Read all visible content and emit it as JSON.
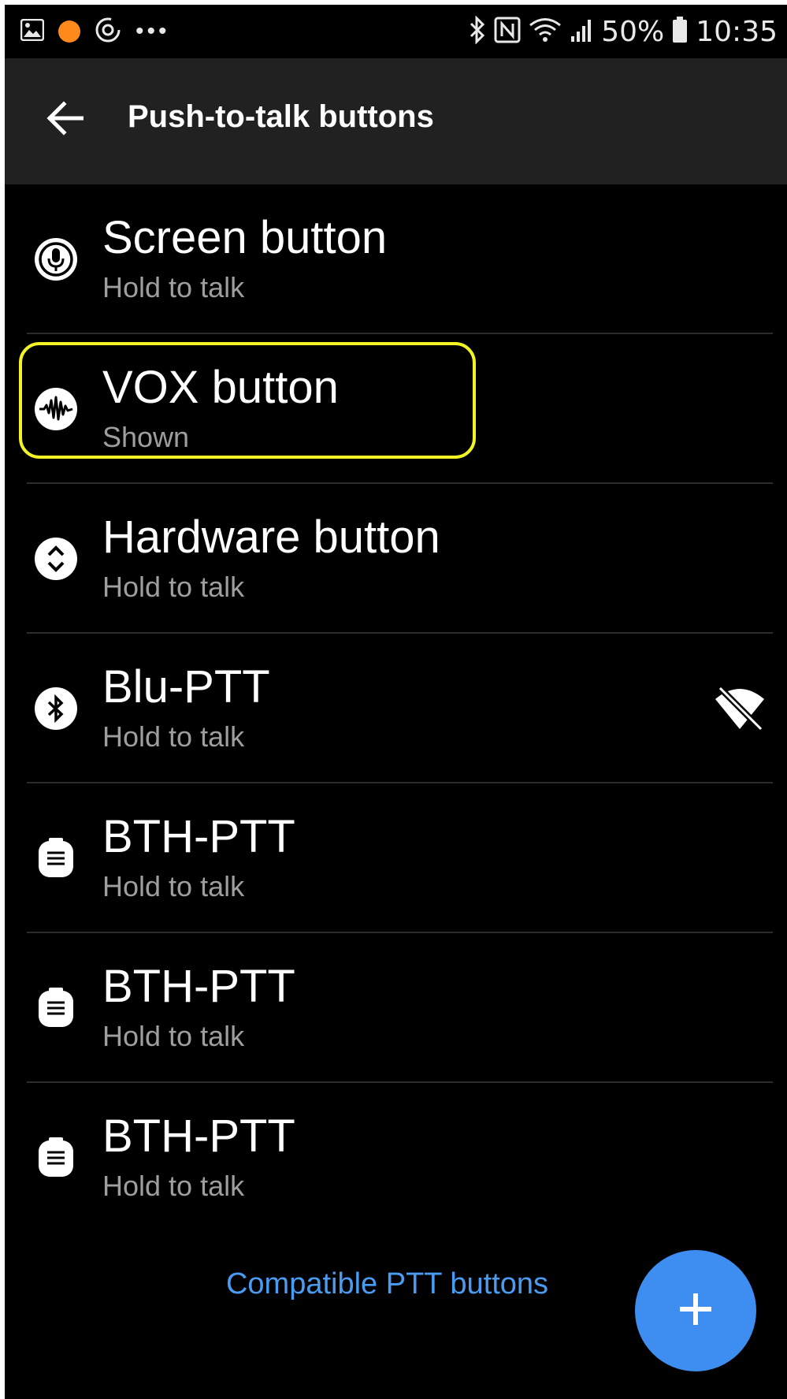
{
  "status_bar": {
    "battery_percent": "50%",
    "time": "10:35",
    "overflow_dots": "•••",
    "icons_left": [
      "image-icon",
      "orange-dot-icon",
      "sync-icon"
    ],
    "icons_right": [
      "bluetooth-icon",
      "nfc-icon",
      "wifi-icon",
      "signal-icon",
      "battery-icon"
    ]
  },
  "app_bar": {
    "title": "Push-to-talk buttons",
    "back_icon": "arrow-left-icon"
  },
  "items": [
    {
      "title": "Screen button",
      "subtitle": "Hold to talk",
      "icon": "microphone-icon",
      "highlighted": false,
      "trailing_icon": ""
    },
    {
      "title": "VOX button",
      "subtitle": "Shown",
      "icon": "waveform-icon",
      "highlighted": true,
      "trailing_icon": ""
    },
    {
      "title": "Hardware button",
      "subtitle": "Hold to talk",
      "icon": "chevron-up-down-icon",
      "highlighted": false,
      "trailing_icon": ""
    },
    {
      "title": "Blu-PTT",
      "subtitle": "Hold to talk",
      "icon": "bluetooth-icon",
      "highlighted": false,
      "trailing_icon": "signal-off-icon"
    },
    {
      "title": "BTH-PTT",
      "subtitle": "Hold to talk",
      "icon": "ptt-device-icon",
      "highlighted": false,
      "trailing_icon": ""
    },
    {
      "title": "BTH-PTT",
      "subtitle": "Hold to talk",
      "icon": "ptt-device-icon",
      "highlighted": false,
      "trailing_icon": ""
    },
    {
      "title": "BTH-PTT",
      "subtitle": "Hold to talk",
      "icon": "ptt-device-icon",
      "highlighted": false,
      "trailing_icon": ""
    }
  ],
  "footer": {
    "link_text": "Compatible PTT buttons"
  },
  "fab": {
    "icon": "plus-icon"
  },
  "colors": {
    "background": "#000000",
    "app_bar": "#212121",
    "accent": "#3d8ef0",
    "link": "#4a9cf2",
    "highlight_border": "#f2f224",
    "subtitle": "#9e9e9e"
  }
}
